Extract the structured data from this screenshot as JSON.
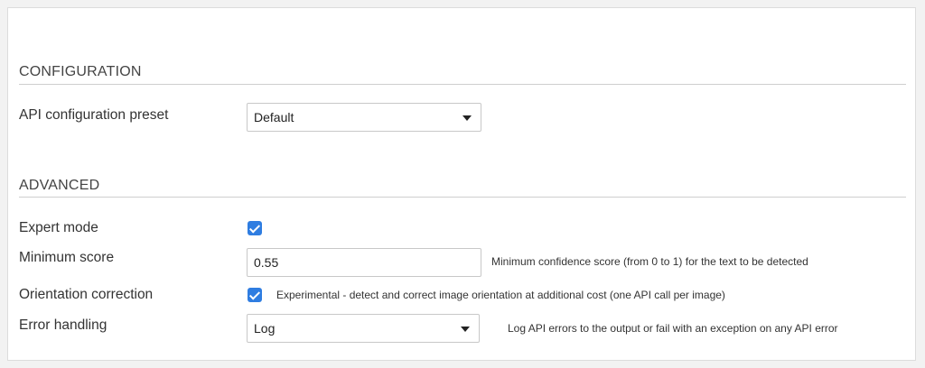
{
  "configuration": {
    "title": "CONFIGURATION",
    "preset_label": "API configuration preset",
    "preset_value": "Default"
  },
  "advanced": {
    "title": "ADVANCED",
    "expert_mode_label": "Expert mode",
    "expert_mode_checked": true,
    "min_score_label": "Minimum score",
    "min_score_value": "0.55",
    "min_score_help": "Minimum confidence score (from 0 to 1) for the text to be detected",
    "orientation_label": "Orientation correction",
    "orientation_checked": true,
    "orientation_help": "Experimental - detect and correct image orientation at additional cost (one API call per image)",
    "error_label": "Error handling",
    "error_value": "Log",
    "error_help": "Log API errors to the output or fail with an exception on any API error"
  },
  "colors": {
    "checkbox": "#2f7de1",
    "panel_border": "#dcdcdc"
  }
}
